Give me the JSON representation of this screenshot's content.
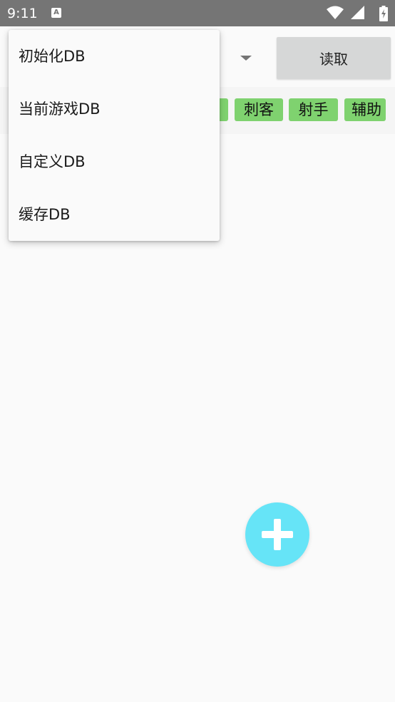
{
  "status_bar": {
    "time": "9:11",
    "notification_icon": "a-icon",
    "icons": [
      "wifi-icon",
      "signal-icon",
      "battery-icon"
    ]
  },
  "toolbar": {
    "read_button_label": "读取"
  },
  "tags": [
    "刺客",
    "射手",
    "辅助"
  ],
  "menu": {
    "items": [
      "初始化DB",
      "当前游戏DB",
      "自定义DB",
      "缓存DB"
    ]
  },
  "fab": {
    "icon": "plus-icon"
  },
  "colors": {
    "status_bar": "#757575",
    "tag_green": "#7fd26f",
    "fab_cyan": "#66e4f7",
    "button_gray": "#d6d7d7"
  }
}
